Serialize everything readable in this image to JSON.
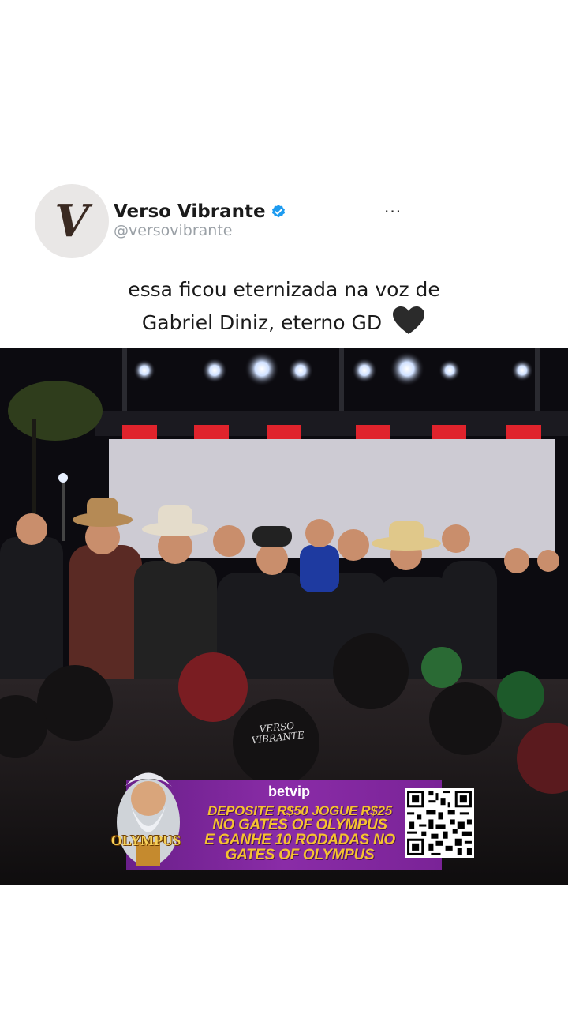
{
  "post": {
    "display_name": "Verso Vibrante",
    "handle": "@versovibrante",
    "more_label": "···",
    "avatar_letter": "V",
    "caption_line1": "essa ficou eternizada na voz de",
    "caption_line2": "Gabriel Diniz, eterno GD"
  },
  "video": {
    "watermark_line1": "VERSO",
    "watermark_line2": "VIBRANTE"
  },
  "ad": {
    "brand": "betvip",
    "line1": "DEPOSITE R$50 JOGUE R$25",
    "line2": "NO GATES OF OLYMPUS",
    "line3": "E GANHE 10 RODADAS NO",
    "line4": "GATES OF OLYMPUS",
    "game_name": "OLYMPUS"
  },
  "colors": {
    "verified": "#1d9bf0",
    "ad_purple": "#7a2397",
    "ad_yellow": "#f5c230"
  },
  "icons": [
    "verified-badge-icon",
    "more-options-icon",
    "black-heart-icon",
    "qr-code-icon"
  ]
}
